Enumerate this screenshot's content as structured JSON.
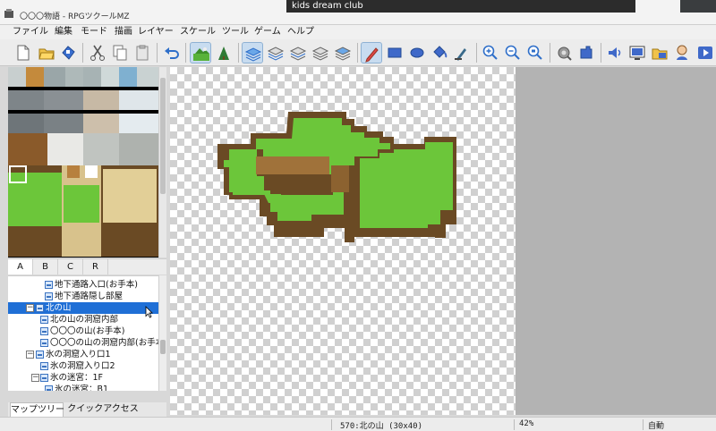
{
  "window": {
    "title": "〇〇〇物語 - RPGツクールMZ"
  },
  "overlay": {
    "label": "kids dream club"
  },
  "menu": [
    "ファイル",
    "編集",
    "モード",
    "描画",
    "レイヤー",
    "スケール",
    "ツール",
    "ゲーム",
    "ヘルプ"
  ],
  "toolbar_icons": [
    "new-project-icon",
    "open-project-icon",
    "save-project-icon",
    "cut-icon",
    "copy-icon",
    "paste-icon",
    "undo-icon",
    "map-mode-icon",
    "event-mode-icon",
    "layer-auto-icon",
    "layer-1-icon",
    "layer-2-icon",
    "layer-3-icon",
    "layer-4-icon",
    "pencil-icon",
    "rectangle-icon",
    "ellipse-icon",
    "flood-fill-icon",
    "shadow-pen-icon",
    "zoom-in-icon",
    "zoom-out-icon",
    "zoom-actual-icon",
    "database-icon",
    "plugin-manager-icon",
    "sound-test-icon",
    "event-searcher-icon",
    "resource-manager-icon",
    "character-generator-icon",
    "playtest-icon"
  ],
  "tileset": {
    "tabs": [
      "A",
      "B",
      "C",
      "R"
    ],
    "active_tab": "A"
  },
  "map_tree": {
    "rows": [
      {
        "label": "地下通路入口(お手本)",
        "indent": 2,
        "toggle": "",
        "selected": false
      },
      {
        "label": "地下通路隠し部屋",
        "indent": 2,
        "toggle": "",
        "selected": false
      },
      {
        "label": "北の山",
        "indent": 0,
        "toggle": "−",
        "selected": true
      },
      {
        "label": "北の山の洞窟内部",
        "indent": 1,
        "toggle": "",
        "selected": false
      },
      {
        "label": "〇〇〇の山(お手本)",
        "indent": 1,
        "toggle": "",
        "selected": false
      },
      {
        "label": "〇〇〇の山の洞窟内部(お手本",
        "indent": 1,
        "toggle": "",
        "selected": false
      },
      {
        "label": "氷の洞窟入り口1",
        "indent": 0,
        "toggle": "−",
        "selected": false
      },
      {
        "label": "氷の洞窟入り口2",
        "indent": 1,
        "toggle": "",
        "selected": false
      },
      {
        "label": "氷の迷宮：1F",
        "indent": 1,
        "toggle": "−",
        "selected": false
      },
      {
        "label": "氷の迷宮：B1",
        "indent": 2,
        "toggle": "",
        "selected": false
      }
    ]
  },
  "bottom_tabs": [
    "マップツリー",
    "クイックアクセス"
  ],
  "status": {
    "map_info": "570:北の山 (30x40)",
    "zoom": "42%",
    "mode": "自動"
  },
  "colors": {
    "accent": "#1f6fd6",
    "grass": "#6cc63a",
    "dirt": "#6e4a1f",
    "cliff": "#a0723a"
  }
}
